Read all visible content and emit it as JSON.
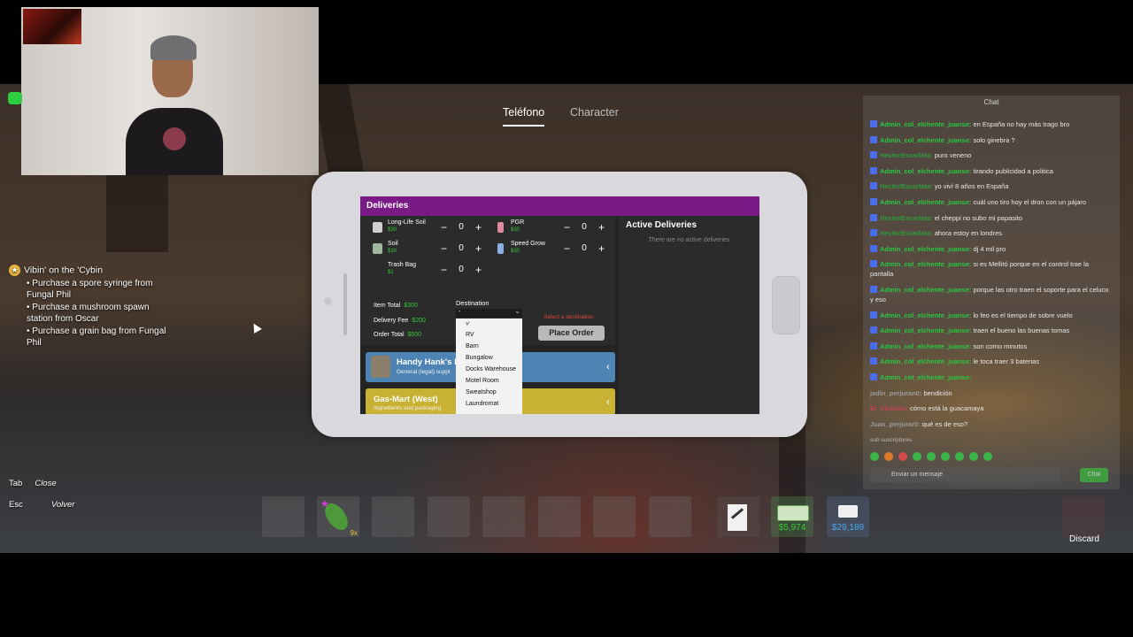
{
  "tabs": {
    "phone": "Teléfono",
    "character": "Character"
  },
  "objective": {
    "title": "Vibin' on the 'Cybin",
    "tasks": [
      "• Purchase a spore syringe from Fungal Phil",
      "• Purchase a mushroom spawn station from Oscar",
      "• Purchase a grain bag from Fungal Phil"
    ]
  },
  "hints": {
    "tab_key": "Tab",
    "tab_action": "Close",
    "esc_key": "Esc",
    "esc_action": "Volver"
  },
  "app": {
    "title": "Deliveries",
    "items": [
      {
        "name": "Long-Life Soil",
        "price": "$30",
        "qty": "0"
      },
      {
        "name": "PGR",
        "price": "$30",
        "qty": "0"
      },
      {
        "name": "Soil",
        "price": "$10",
        "qty": "0"
      },
      {
        "name": "Speed Grow",
        "price": "$30",
        "qty": "0"
      },
      {
        "name": "Trash Bag",
        "price": "$1",
        "qty": "0"
      }
    ],
    "minus": "−",
    "plus": "+",
    "item_total_label": "Item Total",
    "item_total": "$300",
    "delivery_fee_label": "Delivery Fee",
    "delivery_fee": "$200",
    "order_total_label": "Order Total",
    "order_total": "$500",
    "destination_label": "Destination",
    "destination_value": "-",
    "destination_warning": "Select a destination",
    "place_order": "Place Order",
    "active_title": "Active Deliveries",
    "active_empty": "There are no active deliveries",
    "dropdown_options": [
      "-",
      "RV",
      "Barn",
      "Bungalow",
      "Docks Warehouse",
      "Motel Room",
      "Sweatshop",
      "Laundromat"
    ],
    "check": "✓",
    "vendors": [
      {
        "name": "Handy Hank's I",
        "desc": "General (legal) suppl",
        "color": "#4d84b4"
      },
      {
        "name": "Gas-Mart (West)",
        "desc": "Ingredients and packaging",
        "color": "#c9b233"
      }
    ],
    "arrow": "‹"
  },
  "chat": {
    "title": "Chat",
    "messages": [
      {
        "user": "Admin_col_elchente_juanse:",
        "text": "en España no hay más trago bro"
      },
      {
        "user": "Admin_col_elchente_juanse:",
        "text": "solo ginebra ?"
      },
      {
        "user": "HectorEscarlata:",
        "text": "puro veneno"
      },
      {
        "user": "Admin_col_elchente_juanse:",
        "text": "tirando publicidad a politica"
      },
      {
        "user": "HectorEscarlata:",
        "text": "yo viví 8 años en España"
      },
      {
        "user": "Admin_col_elchente_juanse:",
        "text": "cuál uno tiro hoy el dron con un pájaro"
      },
      {
        "user": "HectorEscarlata:",
        "text": "el cheppi no subo mi papasito"
      },
      {
        "user": "HectorEscarlata:",
        "text": "ahora estoy en londres"
      },
      {
        "user": "Admin_col_elchente_juanse:",
        "text": "dj 4 mil pro"
      },
      {
        "user": "Admin_col_elchente_juanse:",
        "text": "si es Mellitó porque en el control trae la pantalla"
      },
      {
        "user": "Admin_col_elchente_juanse:",
        "text": "porque las otro traen el soporte para el celuco y eso"
      },
      {
        "user": "Admin_col_elchente_juanse:",
        "text": "lo feo es el tiempo de sobre vuelo"
      },
      {
        "user": "Admin_col_elchente_juanse:",
        "text": "traen el bueno las buenas tomas"
      },
      {
        "user": "Admin_col_elchente_juanse:",
        "text": "son como minutos"
      },
      {
        "user": "Admin_col_elchente_juanse:",
        "text": "le toca traer 3 baterias"
      },
      {
        "user": "Admin_col_elchente_juanse:",
        "text": ""
      },
      {
        "user": "jadin_perjuran0:",
        "text": "bendición"
      },
      {
        "user": "El_Charrito:",
        "text": "cómo está la guacamaya"
      },
      {
        "user": "Juan_perjurar0:",
        "text": "qué es de eso?"
      }
    ],
    "subscribers": "sub suscriptores",
    "input_placeholder": "Enviar un mensaje",
    "send": "Chat"
  },
  "hotbar": {
    "leaf_count": "9x",
    "cash": "$5,974",
    "bank": "$29,189",
    "discard": "Discard"
  }
}
